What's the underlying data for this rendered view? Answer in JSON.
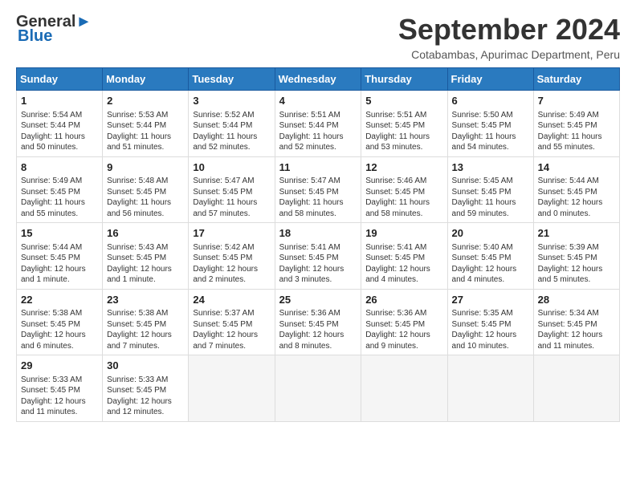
{
  "logo": {
    "line1": "General",
    "line2": "Blue"
  },
  "title": "September 2024",
  "subtitle": "Cotabambas, Apurimac Department, Peru",
  "weekdays": [
    "Sunday",
    "Monday",
    "Tuesday",
    "Wednesday",
    "Thursday",
    "Friday",
    "Saturday"
  ],
  "weeks": [
    [
      {
        "day": "1",
        "info": "Sunrise: 5:54 AM\nSunset: 5:44 PM\nDaylight: 11 hours\nand 50 minutes."
      },
      {
        "day": "2",
        "info": "Sunrise: 5:53 AM\nSunset: 5:44 PM\nDaylight: 11 hours\nand 51 minutes."
      },
      {
        "day": "3",
        "info": "Sunrise: 5:52 AM\nSunset: 5:44 PM\nDaylight: 11 hours\nand 52 minutes."
      },
      {
        "day": "4",
        "info": "Sunrise: 5:51 AM\nSunset: 5:44 PM\nDaylight: 11 hours\nand 52 minutes."
      },
      {
        "day": "5",
        "info": "Sunrise: 5:51 AM\nSunset: 5:45 PM\nDaylight: 11 hours\nand 53 minutes."
      },
      {
        "day": "6",
        "info": "Sunrise: 5:50 AM\nSunset: 5:45 PM\nDaylight: 11 hours\nand 54 minutes."
      },
      {
        "day": "7",
        "info": "Sunrise: 5:49 AM\nSunset: 5:45 PM\nDaylight: 11 hours\nand 55 minutes."
      }
    ],
    [
      {
        "day": "8",
        "info": "Sunrise: 5:49 AM\nSunset: 5:45 PM\nDaylight: 11 hours\nand 55 minutes."
      },
      {
        "day": "9",
        "info": "Sunrise: 5:48 AM\nSunset: 5:45 PM\nDaylight: 11 hours\nand 56 minutes."
      },
      {
        "day": "10",
        "info": "Sunrise: 5:47 AM\nSunset: 5:45 PM\nDaylight: 11 hours\nand 57 minutes."
      },
      {
        "day": "11",
        "info": "Sunrise: 5:47 AM\nSunset: 5:45 PM\nDaylight: 11 hours\nand 58 minutes."
      },
      {
        "day": "12",
        "info": "Sunrise: 5:46 AM\nSunset: 5:45 PM\nDaylight: 11 hours\nand 58 minutes."
      },
      {
        "day": "13",
        "info": "Sunrise: 5:45 AM\nSunset: 5:45 PM\nDaylight: 11 hours\nand 59 minutes."
      },
      {
        "day": "14",
        "info": "Sunrise: 5:44 AM\nSunset: 5:45 PM\nDaylight: 12 hours\nand 0 minutes."
      }
    ],
    [
      {
        "day": "15",
        "info": "Sunrise: 5:44 AM\nSunset: 5:45 PM\nDaylight: 12 hours\nand 1 minute."
      },
      {
        "day": "16",
        "info": "Sunrise: 5:43 AM\nSunset: 5:45 PM\nDaylight: 12 hours\nand 1 minute."
      },
      {
        "day": "17",
        "info": "Sunrise: 5:42 AM\nSunset: 5:45 PM\nDaylight: 12 hours\nand 2 minutes."
      },
      {
        "day": "18",
        "info": "Sunrise: 5:41 AM\nSunset: 5:45 PM\nDaylight: 12 hours\nand 3 minutes."
      },
      {
        "day": "19",
        "info": "Sunrise: 5:41 AM\nSunset: 5:45 PM\nDaylight: 12 hours\nand 4 minutes."
      },
      {
        "day": "20",
        "info": "Sunrise: 5:40 AM\nSunset: 5:45 PM\nDaylight: 12 hours\nand 4 minutes."
      },
      {
        "day": "21",
        "info": "Sunrise: 5:39 AM\nSunset: 5:45 PM\nDaylight: 12 hours\nand 5 minutes."
      }
    ],
    [
      {
        "day": "22",
        "info": "Sunrise: 5:38 AM\nSunset: 5:45 PM\nDaylight: 12 hours\nand 6 minutes."
      },
      {
        "day": "23",
        "info": "Sunrise: 5:38 AM\nSunset: 5:45 PM\nDaylight: 12 hours\nand 7 minutes."
      },
      {
        "day": "24",
        "info": "Sunrise: 5:37 AM\nSunset: 5:45 PM\nDaylight: 12 hours\nand 7 minutes."
      },
      {
        "day": "25",
        "info": "Sunrise: 5:36 AM\nSunset: 5:45 PM\nDaylight: 12 hours\nand 8 minutes."
      },
      {
        "day": "26",
        "info": "Sunrise: 5:36 AM\nSunset: 5:45 PM\nDaylight: 12 hours\nand 9 minutes."
      },
      {
        "day": "27",
        "info": "Sunrise: 5:35 AM\nSunset: 5:45 PM\nDaylight: 12 hours\nand 10 minutes."
      },
      {
        "day": "28",
        "info": "Sunrise: 5:34 AM\nSunset: 5:45 PM\nDaylight: 12 hours\nand 11 minutes."
      }
    ],
    [
      {
        "day": "29",
        "info": "Sunrise: 5:33 AM\nSunset: 5:45 PM\nDaylight: 12 hours\nand 11 minutes."
      },
      {
        "day": "30",
        "info": "Sunrise: 5:33 AM\nSunset: 5:45 PM\nDaylight: 12 hours\nand 12 minutes."
      },
      {
        "day": "",
        "info": ""
      },
      {
        "day": "",
        "info": ""
      },
      {
        "day": "",
        "info": ""
      },
      {
        "day": "",
        "info": ""
      },
      {
        "day": "",
        "info": ""
      }
    ]
  ]
}
